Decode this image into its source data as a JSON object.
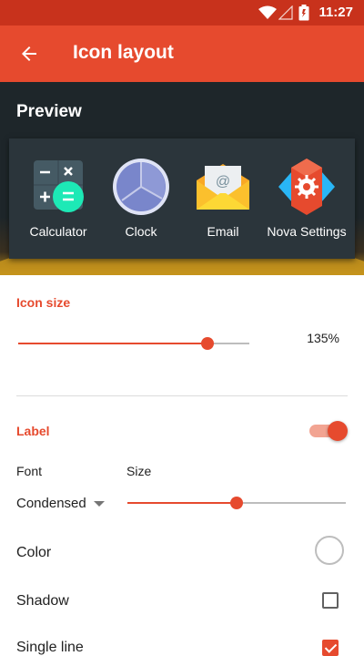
{
  "status_bar": {
    "time": "11:27"
  },
  "toolbar": {
    "title": "Icon layout"
  },
  "preview": {
    "title": "Preview",
    "apps": [
      {
        "label": "Calculator",
        "icon": "calculator-icon"
      },
      {
        "label": "Clock",
        "icon": "clock-icon"
      },
      {
        "label": "Email",
        "icon": "email-icon"
      },
      {
        "label": "Nova Settings",
        "icon": "nova-settings-icon"
      }
    ]
  },
  "icon_size": {
    "heading": "Icon size",
    "value_label": "135%",
    "level": 0.82
  },
  "label": {
    "heading": "Label",
    "enabled": true,
    "font_caption": "Font",
    "size_caption": "Size",
    "font_value": "Condensed",
    "size_level": 0.5,
    "color_label": "Color",
    "shadow_label": "Shadow",
    "shadow_checked": false,
    "single_line_label": "Single line",
    "single_line_checked": true
  },
  "colors": {
    "accent": "#e64a2e",
    "status_bar": "#c8321c",
    "preview_bg": "#1e262a"
  }
}
